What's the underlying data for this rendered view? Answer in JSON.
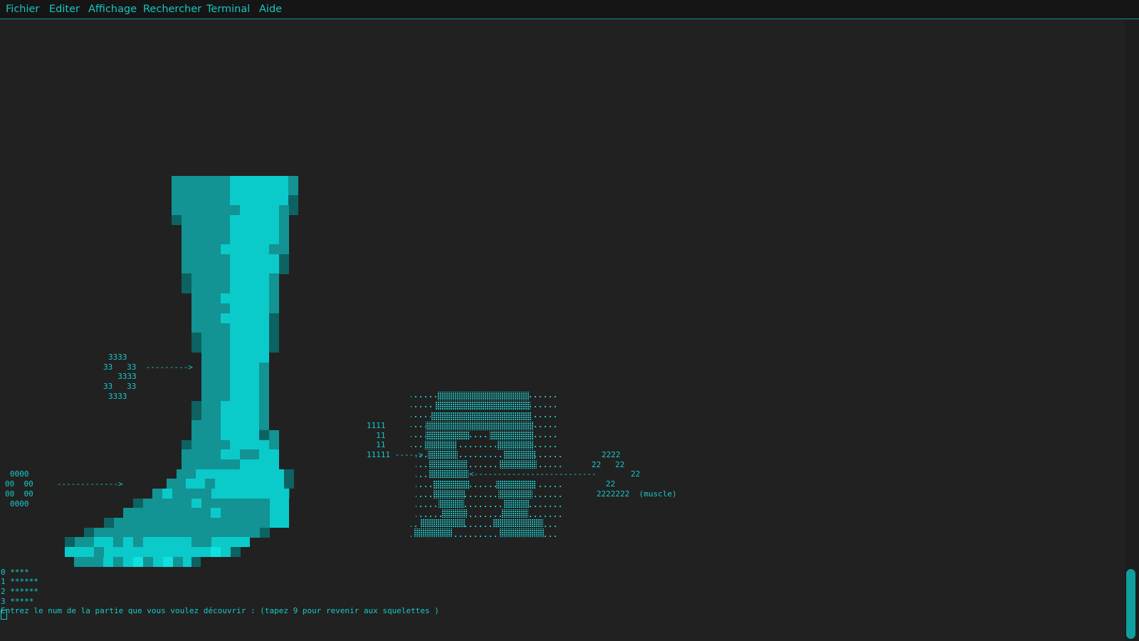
{
  "menu": {
    "items": [
      "Fichier",
      "Editer",
      "Affichage",
      "Rechercher",
      "Terminal",
      "Aide"
    ]
  },
  "colors": {
    "accent": "#19c8c8",
    "background": "#212121",
    "dark_cyan": "#139393",
    "bright_cyan": "#0bcaca"
  },
  "annotations": {
    "bone3": [
      "3333",
      "33   33  --------->",
      "  3333",
      "33   33",
      "3333"
    ],
    "bone0": [
      "0000",
      "00  00     ------------->",
      "00  00",
      "0000"
    ],
    "bone1": [
      "1111",
      "  11",
      "  11",
      "11111 ----->"
    ],
    "bone2": [
      "2222",
      "22   22",
      "22",
      "22",
      "2222222  (muscle)"
    ],
    "arrow_left": "<--------------------------"
  },
  "menu_prompt": {
    "options": [
      "0 ****",
      "1 ******",
      "2 ******",
      "3 *****"
    ],
    "prompt": "Entrez le num de la partie que vous voulez découvrir : (tapez 9 pour revenir aux squelettes )"
  }
}
